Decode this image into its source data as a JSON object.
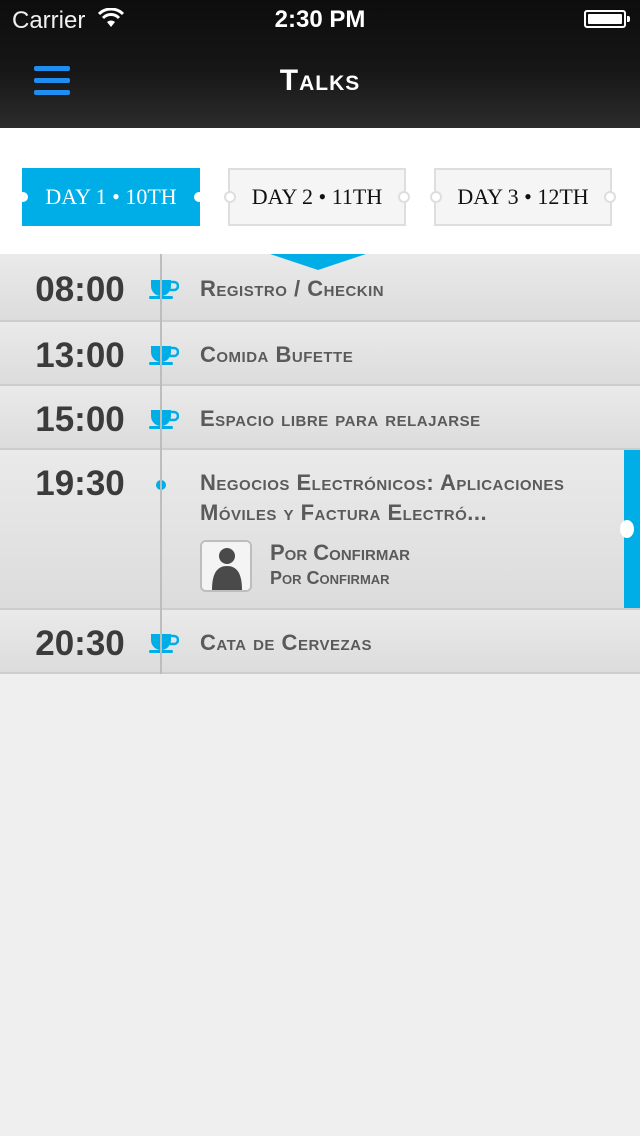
{
  "status_bar": {
    "carrier": "Carrier",
    "time": "2:30 PM"
  },
  "nav": {
    "title": "Talks"
  },
  "tabs": [
    {
      "label": "DAY 1 • 10TH",
      "active": true
    },
    {
      "label": "DAY 2 • 11TH",
      "active": false
    },
    {
      "label": "DAY 3 • 12TH",
      "active": false
    }
  ],
  "schedule": [
    {
      "time": "08:00",
      "title": "Registro / Checkin",
      "icon": "coffee-cup-icon"
    },
    {
      "time": "13:00",
      "title": "Comida Bufette",
      "icon": "coffee-cup-icon"
    },
    {
      "time": "15:00",
      "title": "Espacio libre para relajarse",
      "icon": "coffee-cup-icon"
    },
    {
      "time": "19:30",
      "title_line1": "Negocios Electrónicos: Aplicaciones",
      "title_line2": "Móviles y Factura Electró...",
      "icon": "timeline-dot",
      "speaker": {
        "name": "Por Confirmar",
        "org": "Por Confirmar"
      }
    },
    {
      "time": "20:30",
      "title": "Cata de Cervezas",
      "icon": "coffee-cup-icon"
    }
  ],
  "colors": {
    "accent": "#00aee7",
    "menu": "#1f8ef0",
    "header": "#141414",
    "background": "#efefef"
  }
}
